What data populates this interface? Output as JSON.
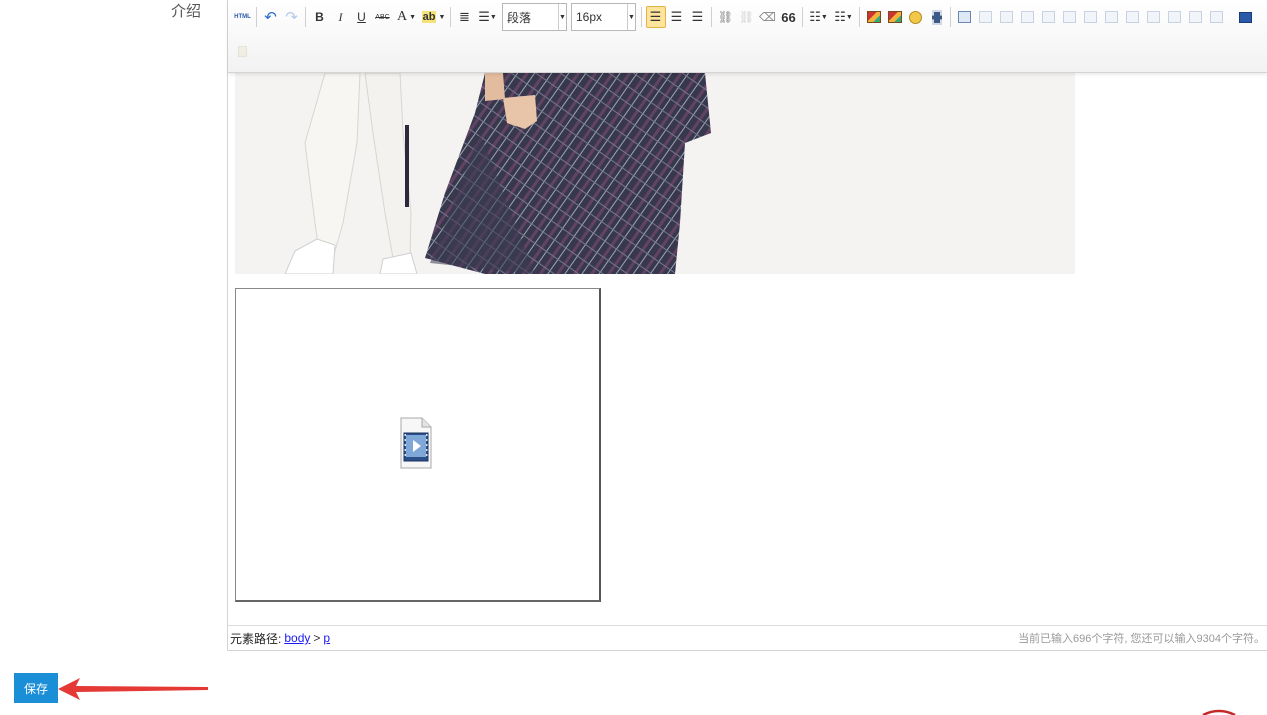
{
  "form": {
    "field_label": "介绍",
    "save_label": "保存"
  },
  "toolbar": {
    "html_label": "HTML",
    "bold": "B",
    "italic": "I",
    "underline": "U",
    "strikethrough": "ABC",
    "font_color": "A",
    "paragraph_format": "段落",
    "font_size": "16px",
    "blockquote": "66"
  },
  "editor": {
    "path_label": "元素路径:",
    "path_body": "body",
    "path_separator": ">",
    "path_p": "p",
    "word_count": "当前已输入696个字符, 您还可以输入9304个字符。"
  },
  "colors": {
    "save_button": "#1a8ed7",
    "annotation_arrow": "#e53935",
    "active_button": "#ffe59b"
  }
}
